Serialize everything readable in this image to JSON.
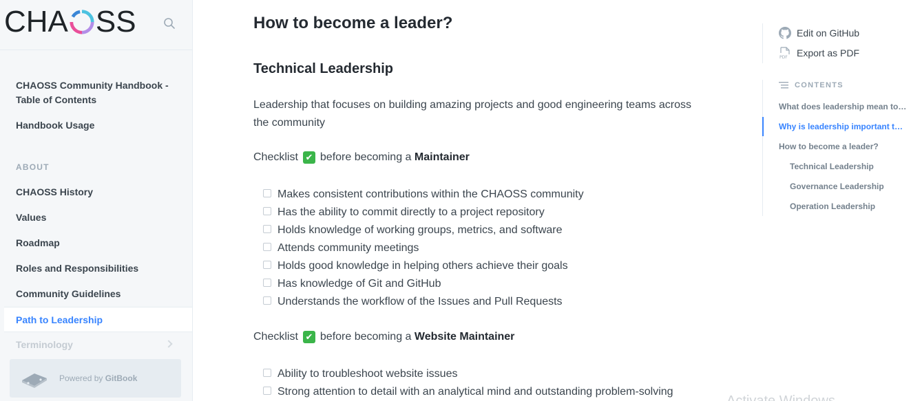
{
  "logo": {
    "text_left": "CHA",
    "text_right": "SS",
    "ring_colors": [
      "#3a86d6",
      "#e94f9a",
      "#b38ee8",
      "#4cc2e0"
    ]
  },
  "sidebar": {
    "top_items": [
      "CHAOSS Community Handbook - Table of Contents",
      "Handbook Usage"
    ],
    "section_title": "ABOUT",
    "items": [
      {
        "label": "CHAOSS History"
      },
      {
        "label": "Values"
      },
      {
        "label": "Roadmap"
      },
      {
        "label": "Roles and Responsibilities"
      },
      {
        "label": "Community Guidelines"
      },
      {
        "label": "Path to Leadership",
        "active": true
      },
      {
        "label": "Terminology"
      }
    ],
    "powered_prefix": "Powered by ",
    "powered_brand": "GitBook"
  },
  "main": {
    "h1": "How to become a leader?",
    "h2": "Technical Leadership",
    "intro": "Leadership that focuses on building amazing projects and good engineering teams across the community",
    "checklist1": {
      "prefix": "Checklist",
      "emoji": "✔",
      "middle": "before becoming a",
      "target": "Maintainer"
    },
    "items1": [
      "Makes consistent contributions within the CHAOSS community",
      "Has the ability to commit directly to a project repository",
      "Holds knowledge of working groups, metrics, and software",
      "Attends community meetings",
      "Holds good knowledge in helping others achieve their goals",
      "Has knowledge of Git and GitHub",
      "Understands the workflow of the Issues and Pull Requests"
    ],
    "checklist2": {
      "prefix": "Checklist",
      "emoji": "✔",
      "middle": "before becoming a",
      "target": "Website Maintainer"
    },
    "items2": [
      "Ability to troubleshoot website issues",
      "Strong attention to detail with an analytical mind and outstanding problem-solving"
    ]
  },
  "right": {
    "edit_github": "Edit on GitHub",
    "export_pdf": "Export as PDF",
    "contents_title": "CONTENTS",
    "toc": [
      {
        "label": "What does leadership mean to t...",
        "level": 1
      },
      {
        "label": "Why is leadership important to u...",
        "level": 1,
        "active": true
      },
      {
        "label": "How to become a leader?",
        "level": 1
      },
      {
        "label": "Technical Leadership",
        "level": 2
      },
      {
        "label": "Governance Leadership",
        "level": 2
      },
      {
        "label": "Operation Leadership",
        "level": 2
      }
    ]
  },
  "watermark": "Activate Windows"
}
